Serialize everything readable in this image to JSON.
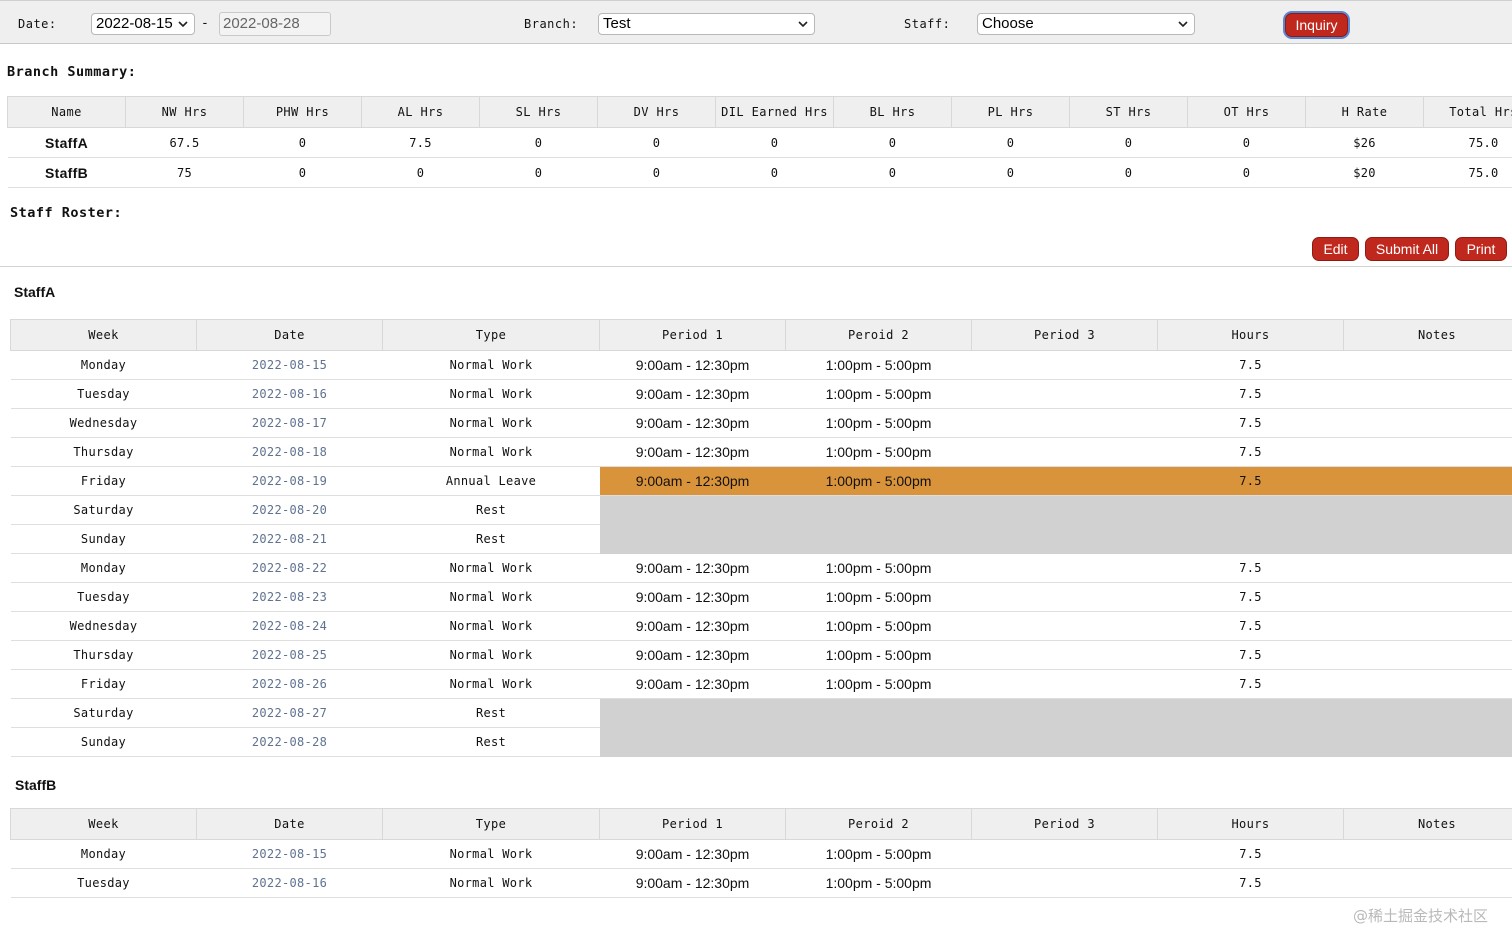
{
  "filters": {
    "date_label": "Date:",
    "date_from": "2022-08-15",
    "date_to": "2022-08-28",
    "separator": "-",
    "branch_label": "Branch:",
    "branch_value": "Test",
    "staff_label": "Staff:",
    "staff_value": "Choose",
    "inquiry_button": "Inquiry"
  },
  "branch_summary": {
    "title": "Branch Summary:",
    "columns": [
      "Name",
      "NW Hrs",
      "PHW Hrs",
      "AL Hrs",
      "SL Hrs",
      "DV Hrs",
      "DIL Earned Hrs",
      "BL Hrs",
      "PL Hrs",
      "ST Hrs",
      "OT Hrs",
      "H Rate",
      "Total Hrs"
    ],
    "rows": [
      [
        "StaffA",
        "67.5",
        "0",
        "7.5",
        "0",
        "0",
        "0",
        "0",
        "0",
        "0",
        "0",
        "$26",
        "75.0"
      ],
      [
        "StaffB",
        "75",
        "0",
        "0",
        "0",
        "0",
        "0",
        "0",
        "0",
        "0",
        "0",
        "$20",
        "75.0"
      ]
    ]
  },
  "staff_roster": {
    "title": "Staff Roster:",
    "buttons": {
      "edit": "Edit",
      "submit_all": "Submit All",
      "print": "Print"
    },
    "columns": [
      "Week",
      "Date",
      "Type",
      "Period 1",
      "Peroid 2",
      "Period 3",
      "Hours",
      "Notes"
    ],
    "staff": [
      {
        "name": "StaffA",
        "rows": [
          {
            "week": "Monday",
            "date": "2022-08-15",
            "type": "Normal Work",
            "p1": "9:00am - 12:30pm",
            "p2": "1:00pm - 5:00pm",
            "p3": "",
            "hours": "7.5",
            "notes": "",
            "state": "normal"
          },
          {
            "week": "Tuesday",
            "date": "2022-08-16",
            "type": "Normal Work",
            "p1": "9:00am - 12:30pm",
            "p2": "1:00pm - 5:00pm",
            "p3": "",
            "hours": "7.5",
            "notes": "",
            "state": "normal"
          },
          {
            "week": "Wednesday",
            "date": "2022-08-17",
            "type": "Normal Work",
            "p1": "9:00am - 12:30pm",
            "p2": "1:00pm - 5:00pm",
            "p3": "",
            "hours": "7.5",
            "notes": "",
            "state": "normal"
          },
          {
            "week": "Thursday",
            "date": "2022-08-18",
            "type": "Normal Work",
            "p1": "9:00am - 12:30pm",
            "p2": "1:00pm - 5:00pm",
            "p3": "",
            "hours": "7.5",
            "notes": "",
            "state": "normal"
          },
          {
            "week": "Friday",
            "date": "2022-08-19",
            "type": "Annual Leave",
            "p1": "9:00am - 12:30pm",
            "p2": "1:00pm - 5:00pm",
            "p3": "",
            "hours": "7.5",
            "notes": "",
            "state": "leave"
          },
          {
            "week": "Saturday",
            "date": "2022-08-20",
            "type": "Rest",
            "p1": "",
            "p2": "",
            "p3": "",
            "hours": "",
            "notes": "",
            "state": "rest"
          },
          {
            "week": "Sunday",
            "date": "2022-08-21",
            "type": "Rest",
            "p1": "",
            "p2": "",
            "p3": "",
            "hours": "",
            "notes": "",
            "state": "rest"
          },
          {
            "week": "Monday",
            "date": "2022-08-22",
            "type": "Normal Work",
            "p1": "9:00am - 12:30pm",
            "p2": "1:00pm - 5:00pm",
            "p3": "",
            "hours": "7.5",
            "notes": "",
            "state": "normal"
          },
          {
            "week": "Tuesday",
            "date": "2022-08-23",
            "type": "Normal Work",
            "p1": "9:00am - 12:30pm",
            "p2": "1:00pm - 5:00pm",
            "p3": "",
            "hours": "7.5",
            "notes": "",
            "state": "normal"
          },
          {
            "week": "Wednesday",
            "date": "2022-08-24",
            "type": "Normal Work",
            "p1": "9:00am - 12:30pm",
            "p2": "1:00pm - 5:00pm",
            "p3": "",
            "hours": "7.5",
            "notes": "",
            "state": "normal"
          },
          {
            "week": "Thursday",
            "date": "2022-08-25",
            "type": "Normal Work",
            "p1": "9:00am - 12:30pm",
            "p2": "1:00pm - 5:00pm",
            "p3": "",
            "hours": "7.5",
            "notes": "",
            "state": "normal"
          },
          {
            "week": "Friday",
            "date": "2022-08-26",
            "type": "Normal Work",
            "p1": "9:00am - 12:30pm",
            "p2": "1:00pm - 5:00pm",
            "p3": "",
            "hours": "7.5",
            "notes": "",
            "state": "normal"
          },
          {
            "week": "Saturday",
            "date": "2022-08-27",
            "type": "Rest",
            "p1": "",
            "p2": "",
            "p3": "",
            "hours": "",
            "notes": "",
            "state": "rest"
          },
          {
            "week": "Sunday",
            "date": "2022-08-28",
            "type": "Rest",
            "p1": "",
            "p2": "",
            "p3": "",
            "hours": "",
            "notes": "",
            "state": "rest"
          }
        ]
      },
      {
        "name": "StaffB",
        "rows": [
          {
            "week": "Monday",
            "date": "2022-08-15",
            "type": "Normal Work",
            "p1": "9:00am - 12:30pm",
            "p2": "1:00pm - 5:00pm",
            "p3": "",
            "hours": "7.5",
            "notes": "",
            "state": "normal"
          },
          {
            "week": "Tuesday",
            "date": "2022-08-16",
            "type": "Normal Work",
            "p1": "9:00am - 12:30pm",
            "p2": "1:00pm - 5:00pm",
            "p3": "",
            "hours": "7.5",
            "notes": "",
            "state": "normal"
          }
        ]
      }
    ]
  },
  "colors": {
    "primary_red": "#c0281e",
    "leave_orange": "#d9933a",
    "rest_gray": "#d1d1d1",
    "date_link": "#5f7290"
  },
  "watermark": "@稀土掘金技术社区"
}
